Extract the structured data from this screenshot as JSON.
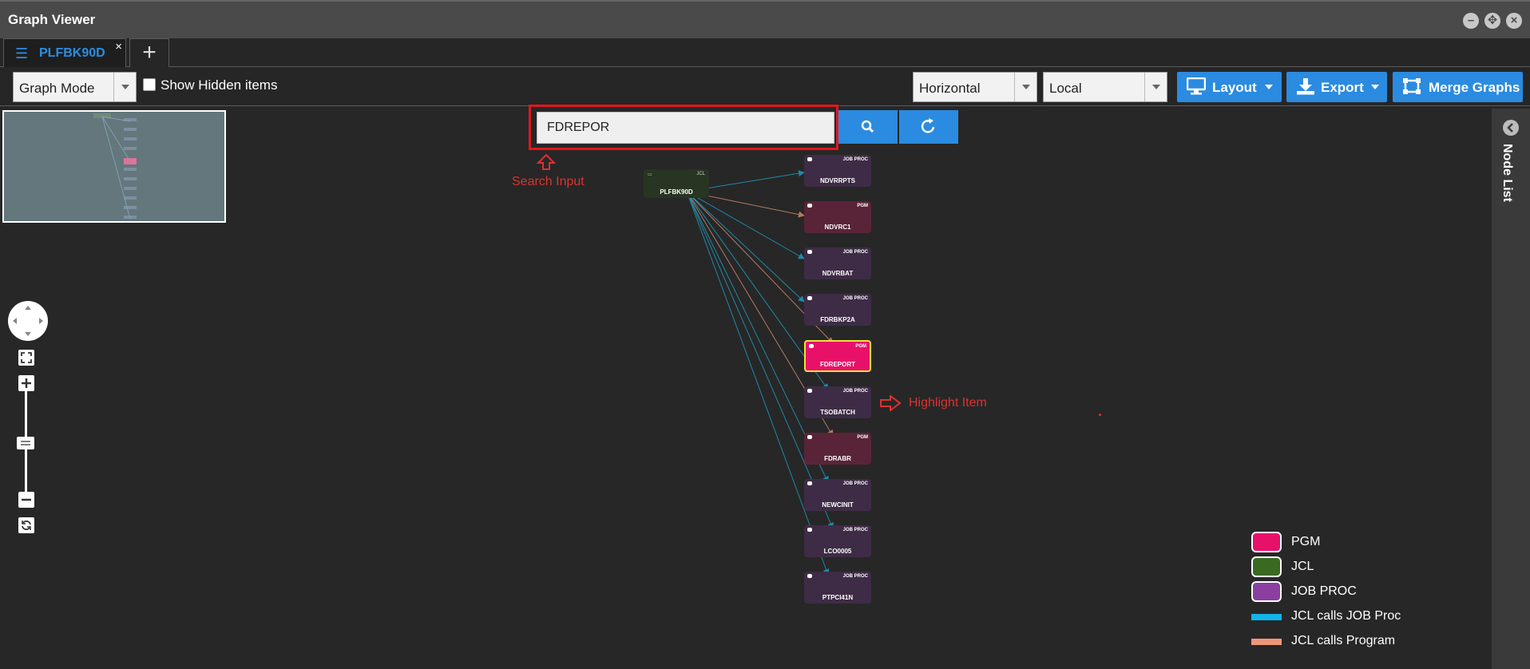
{
  "window": {
    "title": "Graph Viewer"
  },
  "tabs": [
    {
      "label": "PLFBK90D",
      "close": "×",
      "icon": "list-check-icon"
    }
  ],
  "add_tab": "+",
  "toolbar": {
    "mode": "Graph Mode",
    "show_hidden_label": "Show Hidden items",
    "orientation": "Horizontal",
    "scope": "Local",
    "layout_label": "Layout",
    "export_label": "Export",
    "merge_label": "Merge Graphs"
  },
  "search": {
    "value": "FDREPOR"
  },
  "annotations": {
    "search": "Search Input",
    "highlight": "Highlight Item"
  },
  "side_panel": {
    "label": "Node List"
  },
  "graph": {
    "root": {
      "name": "PLFBK90D"
    },
    "nodes": [
      {
        "name": "NDVRRPTS",
        "type": "JOB PROC"
      },
      {
        "name": "NDVRC1",
        "type": "PGM"
      },
      {
        "name": "NDVRBAT",
        "type": "JOB PROC"
      },
      {
        "name": "FDRBKP2A",
        "type": "JOB PROC"
      },
      {
        "name": "FDREPORT",
        "type": "PGM",
        "highlighted": true
      },
      {
        "name": "TSOBATCH",
        "type": "JOB PROC"
      },
      {
        "name": "FDRABR",
        "type": "PGM"
      },
      {
        "name": "NEWCINIT",
        "type": "JOB PROC"
      },
      {
        "name": "LCO0005",
        "type": "JOB PROC"
      },
      {
        "name": "PTPCI41N",
        "type": "JOB PROC"
      }
    ]
  },
  "legend": [
    {
      "label": "PGM",
      "kind": "box",
      "color": "#e8116a"
    },
    {
      "label": "JCL",
      "kind": "box",
      "color": "#3a6a22"
    },
    {
      "label": "JOB PROC",
      "kind": "box",
      "color": "#8a3fa0"
    },
    {
      "label": "JCL calls JOB Proc",
      "kind": "line",
      "color": "#11b4ea"
    },
    {
      "label": "JCL calls Program",
      "kind": "line",
      "color": "#f0977a"
    }
  ],
  "colors": {
    "accent": "#2b8be0",
    "pgm_node": "#5a2438",
    "jobproc_node": "#3e2c46",
    "jcl_node": "#283522",
    "highlight_node": "#e8116a",
    "edge_jobproc": "#1f89a8",
    "edge_program": "#b27a63",
    "annotation": "#e03030"
  }
}
